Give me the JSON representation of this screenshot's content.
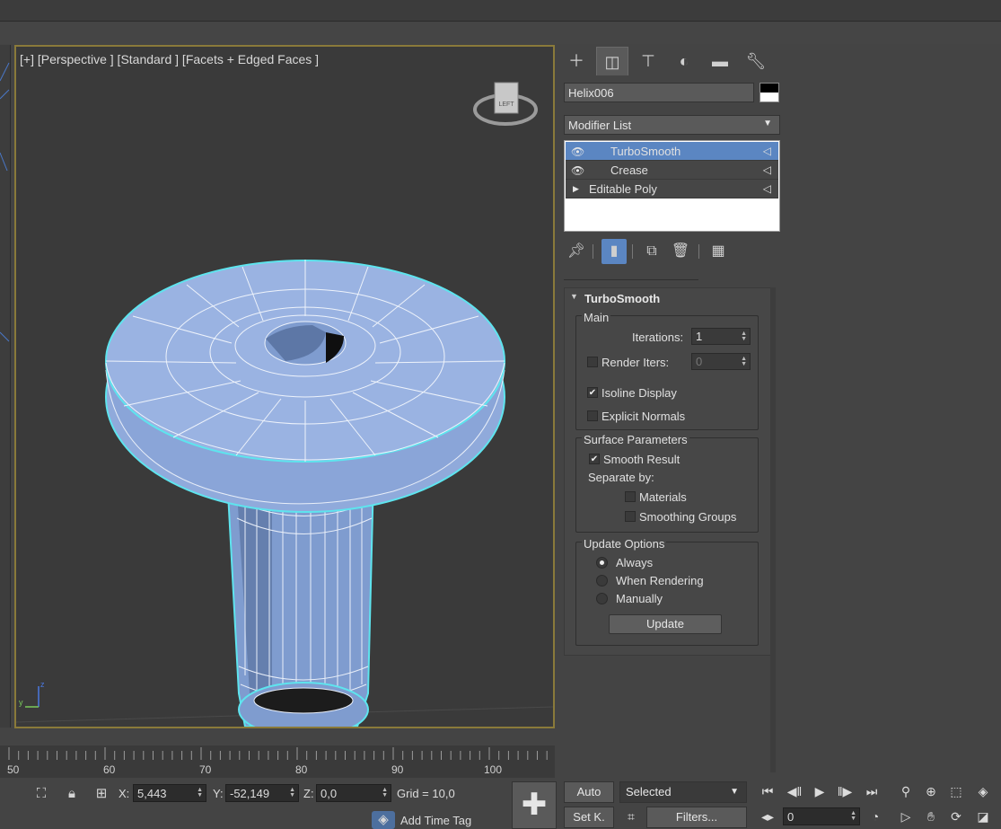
{
  "viewport": {
    "label": "[+] [Perspective ] [Standard ] [Facets + Edged Faces ]",
    "viewcube_face": "LEFT",
    "axis_z": "z",
    "axis_y": "y"
  },
  "command_panel": {
    "tabs": [
      {
        "name": "create-tab",
        "icon": "plus-icon"
      },
      {
        "name": "modify-tab",
        "icon": "modify-icon"
      },
      {
        "name": "hierarchy-tab",
        "icon": "hierarchy-icon"
      },
      {
        "name": "motion-tab",
        "icon": "motion-icon"
      },
      {
        "name": "display-tab",
        "icon": "monitor-icon"
      },
      {
        "name": "utilities-tab",
        "icon": "wrench-icon"
      }
    ],
    "object_name": "Helix006",
    "modifier_list_label": "Modifier List",
    "stack": [
      {
        "label": "TurboSmooth"
      },
      {
        "label": "Crease"
      },
      {
        "label": "Editable Poly"
      }
    ]
  },
  "turbosmooth": {
    "title": "TurboSmooth",
    "main": {
      "title": "Main",
      "iterations_label": "Iterations:",
      "iterations_value": "1",
      "render_iters_label": "Render Iters:",
      "render_iters_value": "0",
      "isoline_label": "Isoline Display",
      "explicit_label": "Explicit Normals"
    },
    "surface": {
      "title": "Surface Parameters",
      "smooth_label": "Smooth Result",
      "separate_label": "Separate by:",
      "materials_label": "Materials",
      "smoothing_label": "Smoothing Groups"
    },
    "update": {
      "title": "Update Options",
      "always": "Always",
      "when_rendering": "When Rendering",
      "manually": "Manually",
      "button": "Update"
    }
  },
  "timeline": {
    "ticks": [
      "50",
      "60",
      "70",
      "80",
      "90",
      "100"
    ]
  },
  "status": {
    "x_label": "X:",
    "x_value": "5,443",
    "y_label": "Y:",
    "y_value": "-52,149",
    "z_label": "Z:",
    "z_value": "0,0",
    "grid": "Grid = 10,0",
    "add_time_tag": "Add Time Tag"
  },
  "anim": {
    "auto": "Auto",
    "selected": "Selected",
    "setk": "Set K.",
    "filters": "Filters...",
    "frame": "0"
  }
}
